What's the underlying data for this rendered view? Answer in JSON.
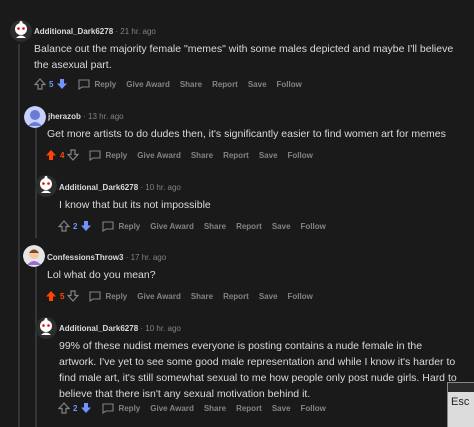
{
  "actions": {
    "reply": "Reply",
    "give_award": "Give Award",
    "share": "Share",
    "report": "Report",
    "save": "Save",
    "follow": "Follow"
  },
  "colors": {
    "upvote_active": "#ff4500",
    "downvote_active": "#7193ff",
    "background": "#1a1a1b"
  },
  "comments": [
    {
      "author": "Additional_Dark6278",
      "time": "21 hr. ago",
      "body": "Balance out the majority female \"memes\" with some males depicted and maybe I'll believe the asexual part.",
      "score": "5",
      "vote_state": "down"
    },
    {
      "author": "jherazob",
      "time": "13 hr. ago",
      "body": "Get more artists to do dudes then, it's significantly easier to find women art for memes",
      "score": "4",
      "vote_state": "up"
    },
    {
      "author": "Additional_Dark6278",
      "time": "10 hr. ago",
      "body": "I know that but its not impossible",
      "score": "2",
      "vote_state": "down"
    },
    {
      "author": "ConfessionsThrow3",
      "time": "17 hr. ago",
      "body": "Lol what do you mean?",
      "score": "5",
      "vote_state": "up"
    },
    {
      "author": "Additional_Dark6278",
      "time": "10 hr. ago",
      "body": "99% of these nudist memes everyone is posting contains a nude female in the artwork. I've yet to see some good male representation and while I know it's harder to find male art, it's still somewhat sexual to me how people only post nude girls. Hard to believe that there isn't any sexual motivation behind it.",
      "score": "2",
      "vote_state": "down"
    }
  ],
  "corner_window": {
    "text": "Esc"
  }
}
